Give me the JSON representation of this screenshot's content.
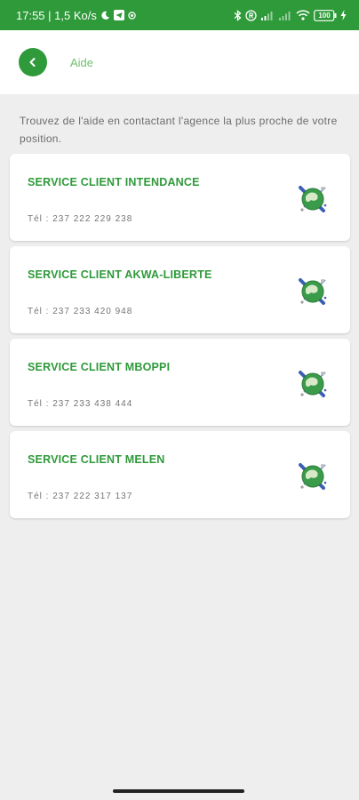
{
  "status_bar": {
    "time_speed": "17:55 | 1,5 Ko/s",
    "battery": "100"
  },
  "header": {
    "title": "Aide",
    "back_icon": "chevron-left-icon"
  },
  "intro_text": "Trouvez de l'aide en contactant l'agence la plus proche de votre position.",
  "services": [
    {
      "name": "SERVICE CLIENT INTENDANCE",
      "phone": "Tél : 237 222 229 238",
      "icon": "globe-icon"
    },
    {
      "name": "SERVICE CLIENT AKWA-LIBERTE",
      "phone": "Tél : 237 233 420 948",
      "icon": "globe-icon"
    },
    {
      "name": "SERVICE CLIENT MBOPPI",
      "phone": "Tél : 237 233 438 444",
      "icon": "globe-icon"
    },
    {
      "name": "SERVICE CLIENT MELEN",
      "phone": "Tél : 237 222 317 137",
      "icon": "globe-icon"
    }
  ],
  "colors": {
    "primary": "#2e9a3a",
    "background": "#eeeeee",
    "card": "#ffffff"
  }
}
